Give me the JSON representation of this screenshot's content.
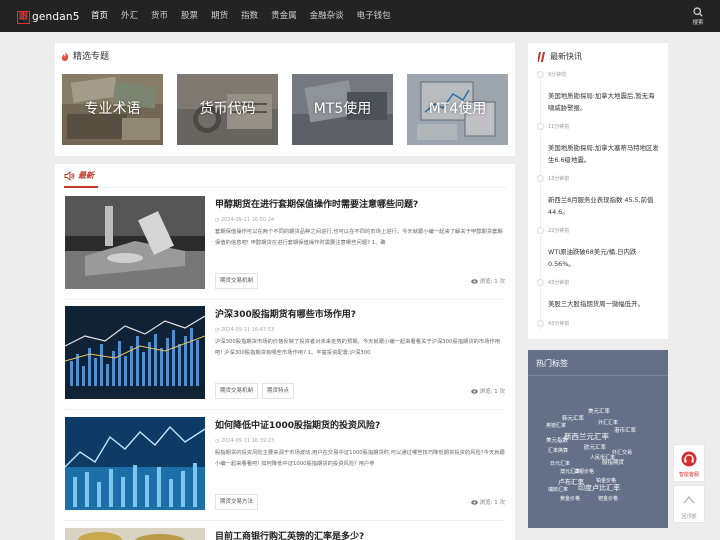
{
  "logo": {
    "mark": "跟",
    "text": "gendan5"
  },
  "nav": {
    "items": [
      "首页",
      "外汇",
      "货币",
      "股票",
      "期货",
      "指数",
      "贵金属",
      "金融杂谈",
      "电子钱包"
    ],
    "search_label": "搜索"
  },
  "featured": {
    "title": "精选专题",
    "topics": [
      "专业术语",
      "货币代码",
      "MT5使用",
      "MT4使用"
    ]
  },
  "latest": {
    "title": "最新",
    "articles": [
      {
        "title": "甲醇期货在进行套期保值操作时需要注意哪些问题?",
        "time": "2024-09-11 16:50:24",
        "excerpt": "套期保值操作可以在两个不同的期货品种之间进行,也可以在不同的市场上进行。今天就跟小编一起来了解关于甲醇期货套期保值的信息吧! 甲醇期货在进行套期保值操作时需要注意哪些问题? 1、确",
        "tags": [
          "期货交易机制"
        ],
        "views_label": "浏览:",
        "views": "1 次"
      },
      {
        "title": "沪深300股指期货有哪些市场作用?",
        "time": "2024-09-11 16:47:53",
        "excerpt": "沪深300股指期货市场的价格反映了投资者对未来走势的预期。今天就跟小编一起来看看关于沪深300股指期货的市场作用吧! 沪深300股指期货有哪些市场作用? 1、丰富投资配置:沪深300",
        "tags": [
          "期货交易机制",
          "期货特点"
        ],
        "views_label": "浏览:",
        "views": "1 次"
      },
      {
        "title": "如何降低中证1000股指期货的投资风险?",
        "time": "2024-09-11 16:39:23",
        "excerpt": "股指期货的投资风险主要来源于市场波动,用户在交易中证1000股指期货时,可以通过哪些技巧降低期货投资的风险?今天就跟小编一起来看看吧! 如何降低中证1000股指期货的投资风险? 用户参",
        "tags": [
          "期货交易方法"
        ],
        "views_label": "浏览:",
        "views": "1 次"
      },
      {
        "title": "目前工商银行购汇英镑的汇率是多少?"
      }
    ]
  },
  "flash": {
    "title": "最新快讯",
    "items": [
      {
        "time": "9分钟前",
        "text": "美国地质勘探局:加拿大地震后,暂无海啸威胁警报。"
      },
      {
        "time": "11分钟前",
        "text": "美国地质勘探局:加拿大塞蒂马特地区发生6.6级地震。"
      },
      {
        "time": "13分钟前",
        "text": "新西兰8月服务业表现指数 45.5,前值44.6。"
      },
      {
        "time": "22分钟前",
        "text": "WTI原油跌破68美元/桶,日内跌0.56%。"
      },
      {
        "time": "43分钟前",
        "text": "美股三大股指期货周一微幅低开。"
      },
      {
        "time": "43分钟前",
        "text": ""
      }
    ]
  },
  "hot_tags": {
    "title": "热门标签",
    "tags": [
      "美元汇率",
      "韩元汇率",
      "外汇汇率",
      "新西兰元汇率",
      "港币汇率",
      "英镑汇率",
      "美元指数",
      "欧元汇率",
      "汇率换算",
      "外汇交易",
      "人民币汇率",
      "日元汇率",
      "股指期货",
      "澳元汇率",
      "卢布汇率",
      "印度卢比汇率",
      "瑞郎汇率",
      "黄金价格",
      "铂金价格",
      "白银价格",
      "钯金价格"
    ]
  },
  "widgets": {
    "service_label": "智能客服",
    "top_label": "回顶部"
  }
}
